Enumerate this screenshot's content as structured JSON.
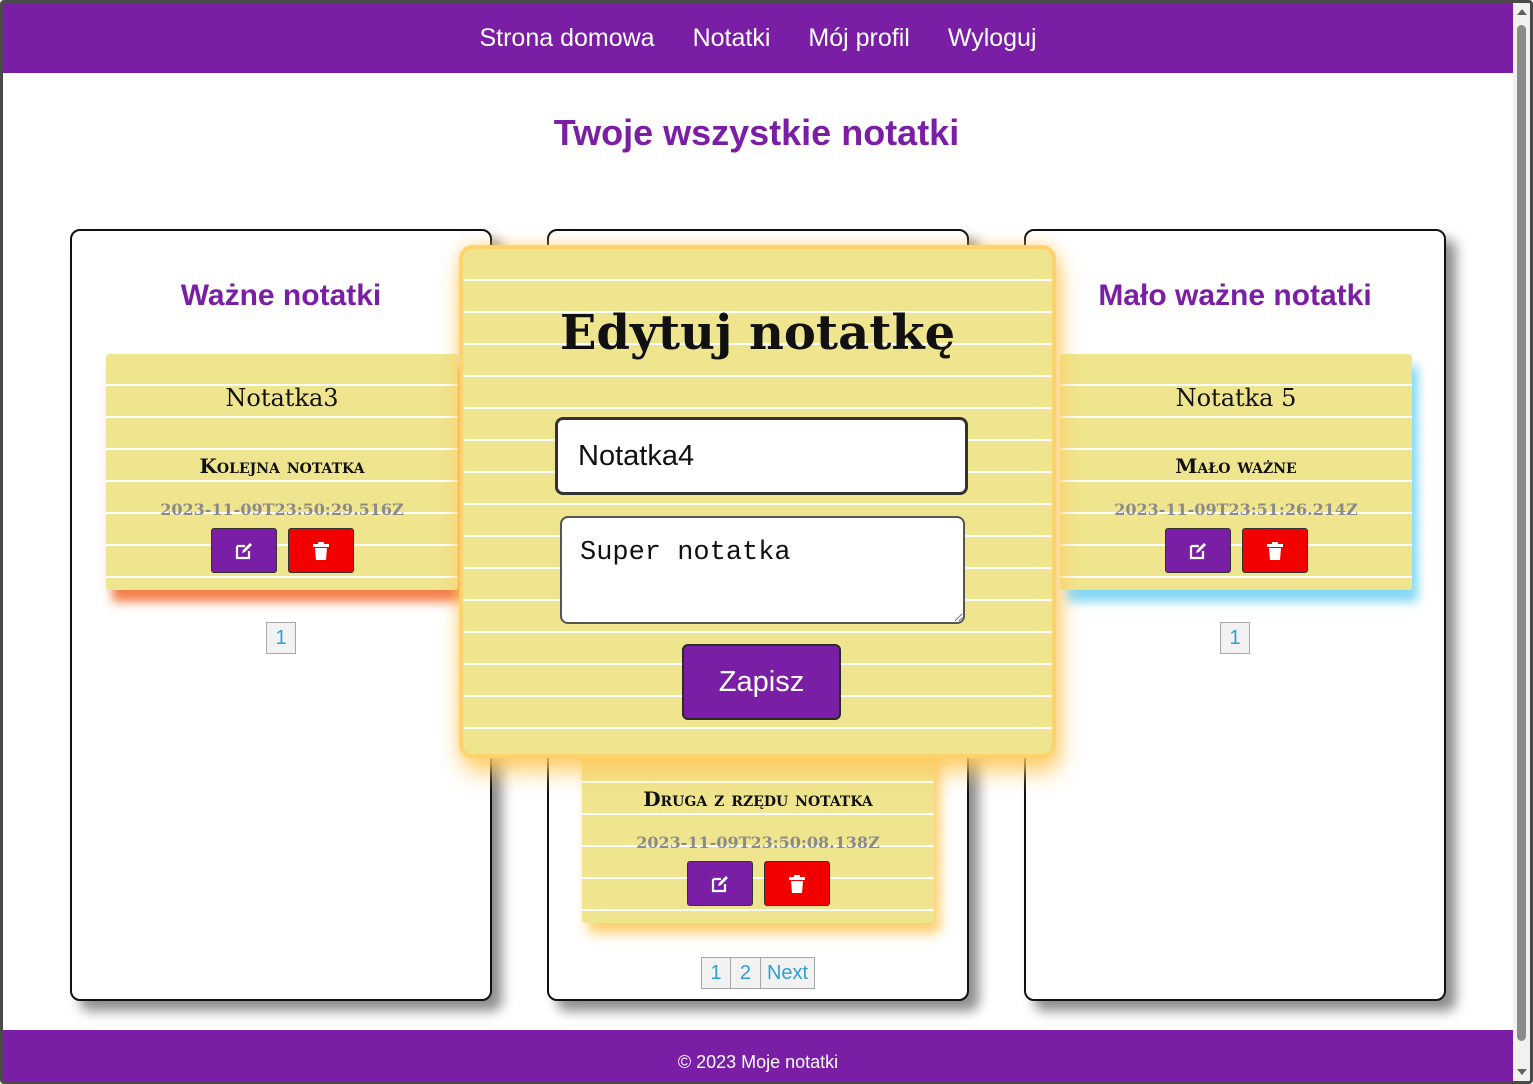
{
  "nav": {
    "items": [
      "Strona domowa",
      "Notatki",
      "Mój profil",
      "Wyloguj"
    ]
  },
  "page": {
    "title": "Twoje wszystkie notatki"
  },
  "columns": [
    {
      "title": "Ważne notatki",
      "note": {
        "title": "Notatka3",
        "body": "Kolejna notatka",
        "date": "2023-11-09T23:50:29.516Z"
      },
      "pagination": [
        "1"
      ],
      "glow_color": "#f06a2a"
    },
    {
      "title": "",
      "note": {
        "title": "",
        "body": "Druga z rzędu notatka",
        "date": "2023-11-09T23:50:08.138Z"
      },
      "pagination": [
        "1",
        "2",
        "Next"
      ],
      "glow_color": "#ffc85a"
    },
    {
      "title": "Mało ważne notatki",
      "note": {
        "title": "Notatka 5",
        "body": "Mało ważne",
        "date": "2023-11-09T23:51:26.214Z"
      },
      "pagination": [
        "1"
      ],
      "glow_color": "#7dd6f5"
    }
  ],
  "modal": {
    "title": "Edytuj notatkę",
    "title_value": "Notatka4",
    "content_value": "Super notatka",
    "save_label": "Zapisz"
  },
  "footer": {
    "text": "© 2023 Moje notatki"
  },
  "colors": {
    "brand": "#7a1ea6",
    "note_paper": "#efe58f",
    "delete": "#f20000",
    "link": "#2f9fd6"
  },
  "icons": {
    "edit": "edit-icon",
    "delete": "trash-icon"
  }
}
